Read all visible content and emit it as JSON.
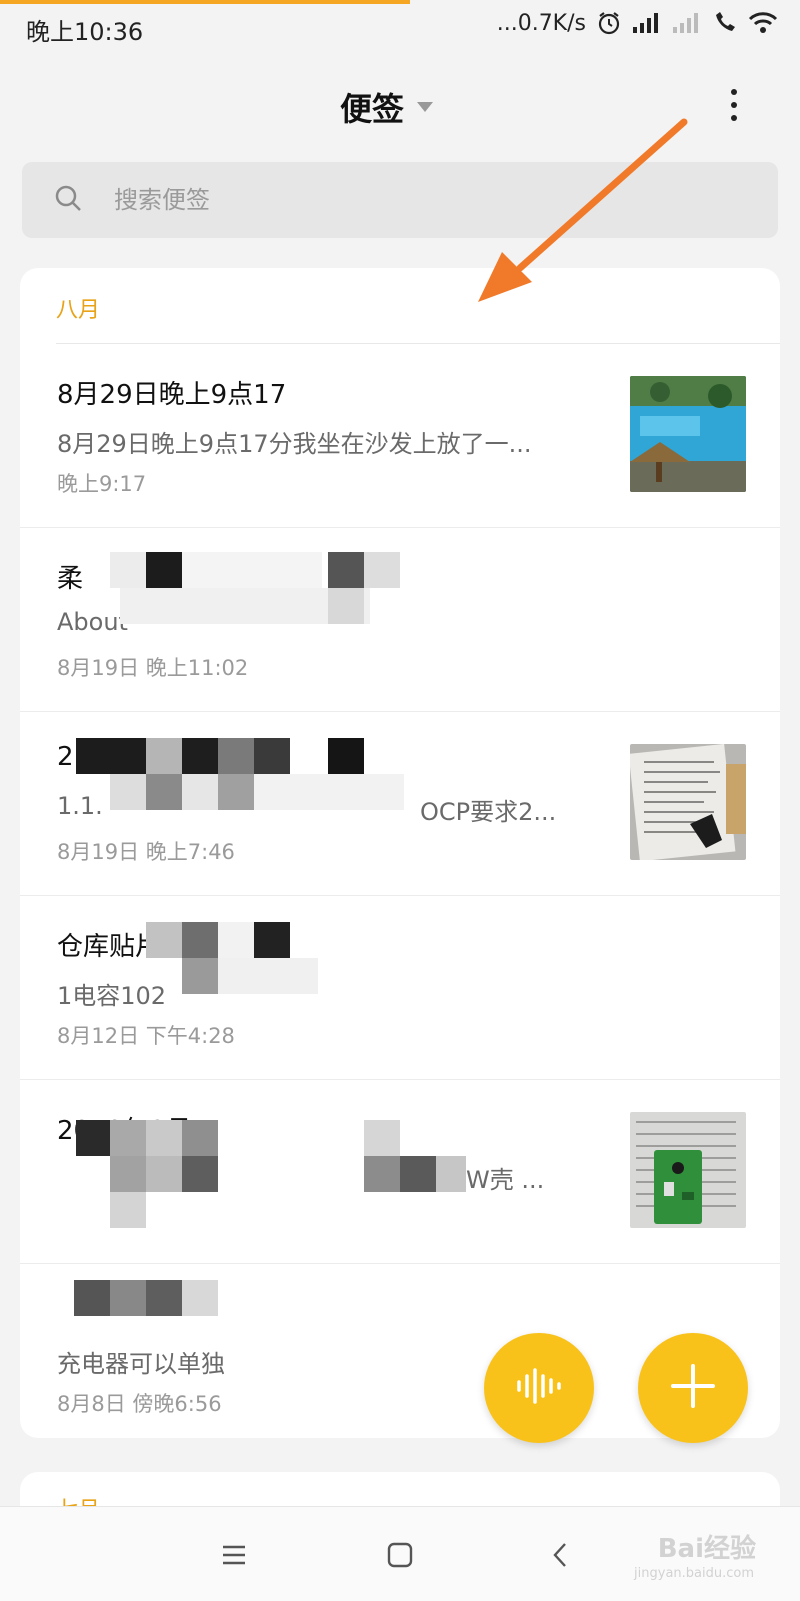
{
  "status_bar": {
    "time": "晚上10:36",
    "net_speed": "...0.7K/s",
    "icons": [
      "alarm-icon",
      "signal-icon",
      "signal-icon",
      "call-icon",
      "wifi-icon"
    ]
  },
  "header": {
    "title": "便签",
    "dropdown_icon": "triangle-down-icon",
    "more_icon": "more-vertical-icon"
  },
  "search": {
    "placeholder": "搜索便签",
    "icon": "search-icon"
  },
  "sections": [
    {
      "label": "八月",
      "notes": [
        {
          "title": "8月29日晚上9点17",
          "preview": "8月29日晚上9点17分我坐在沙发上放了一...",
          "time": "晚上9:17",
          "has_thumbnail": true
        },
        {
          "title": "柔",
          "preview": "About",
          "time": "8月19日 晚上11:02",
          "has_thumbnail": false
        },
        {
          "title": "2",
          "preview": "1.1.",
          "preview_tail": "OCP要求2...",
          "time": "8月19日 晚上7:46",
          "has_thumbnail": true
        },
        {
          "title": "仓库贴片",
          "preview": "1电容102",
          "time": "8月12日 下午4:28",
          "has_thumbnail": false
        },
        {
          "title": "2019年8月",
          "preview_tail": "W壳 ...",
          "time": "",
          "has_thumbnail": true
        },
        {
          "title": "",
          "preview": "充电器可以单独",
          "time": "8月8日 傍晚6:56",
          "has_thumbnail": false
        }
      ]
    },
    {
      "label": "七月"
    }
  ],
  "fabs": {
    "voice_icon": "waveform-icon",
    "add_icon": "plus-icon"
  },
  "nav_bar": {
    "icons": [
      "menu-icon",
      "home-icon",
      "back-icon"
    ]
  },
  "watermark": {
    "text": "Bai经验",
    "sub": "jingyan.baidu.com"
  },
  "colors": {
    "accent": "#f9c21b",
    "section_label": "#e8a317",
    "arrow": "#f07a2a"
  }
}
